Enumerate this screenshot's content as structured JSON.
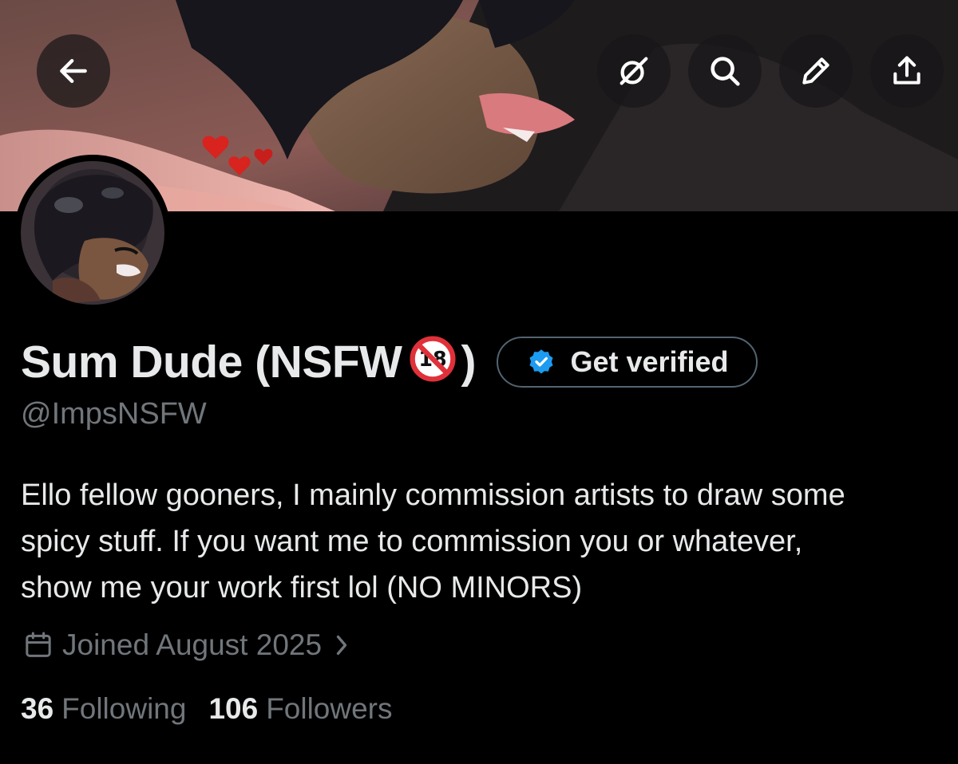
{
  "profile": {
    "display_name": "Sum Dude (NSFW",
    "name_close": ")",
    "handle": "@ImpsNSFW",
    "verify_button_label": "Get verified",
    "bio_lines": [
      "Ello fellow gooners, I mainly commission artists to draw some",
      "spicy stuff. If you want me to commission you or whatever,",
      "show me your work first lol (NO MINORS)"
    ],
    "joined": "Joined August 2025",
    "following_count": "36",
    "following_label": "Following",
    "followers_count": "106",
    "followers_label": "Followers"
  },
  "toolbar": {
    "icons": [
      "back-arrow-icon",
      "grok-icon",
      "search-icon",
      "edit-pencil-icon",
      "share-icon"
    ]
  },
  "colors": {
    "background": "#000000",
    "primary_text": "#e7e9ea",
    "secondary_text": "#71767b",
    "verified_blue": "#1d9bf0",
    "button_border": "#536471"
  }
}
